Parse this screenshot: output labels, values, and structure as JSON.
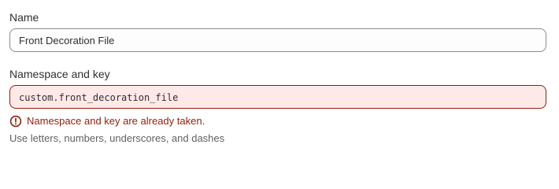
{
  "name_field": {
    "label": "Name",
    "value": "Front Decoration File"
  },
  "namespace_field": {
    "label": "Namespace and key",
    "value": "custom.front_decoration_file",
    "error_message": "Namespace and key are already taken.",
    "help_text": "Use letters, numbers, underscores, and dashes",
    "error_icon": "alert-circle-icon"
  },
  "colors": {
    "error": "#8e1f0b",
    "error_background": "#fee9e8",
    "text": "#303030",
    "subdued_text": "#616161"
  }
}
